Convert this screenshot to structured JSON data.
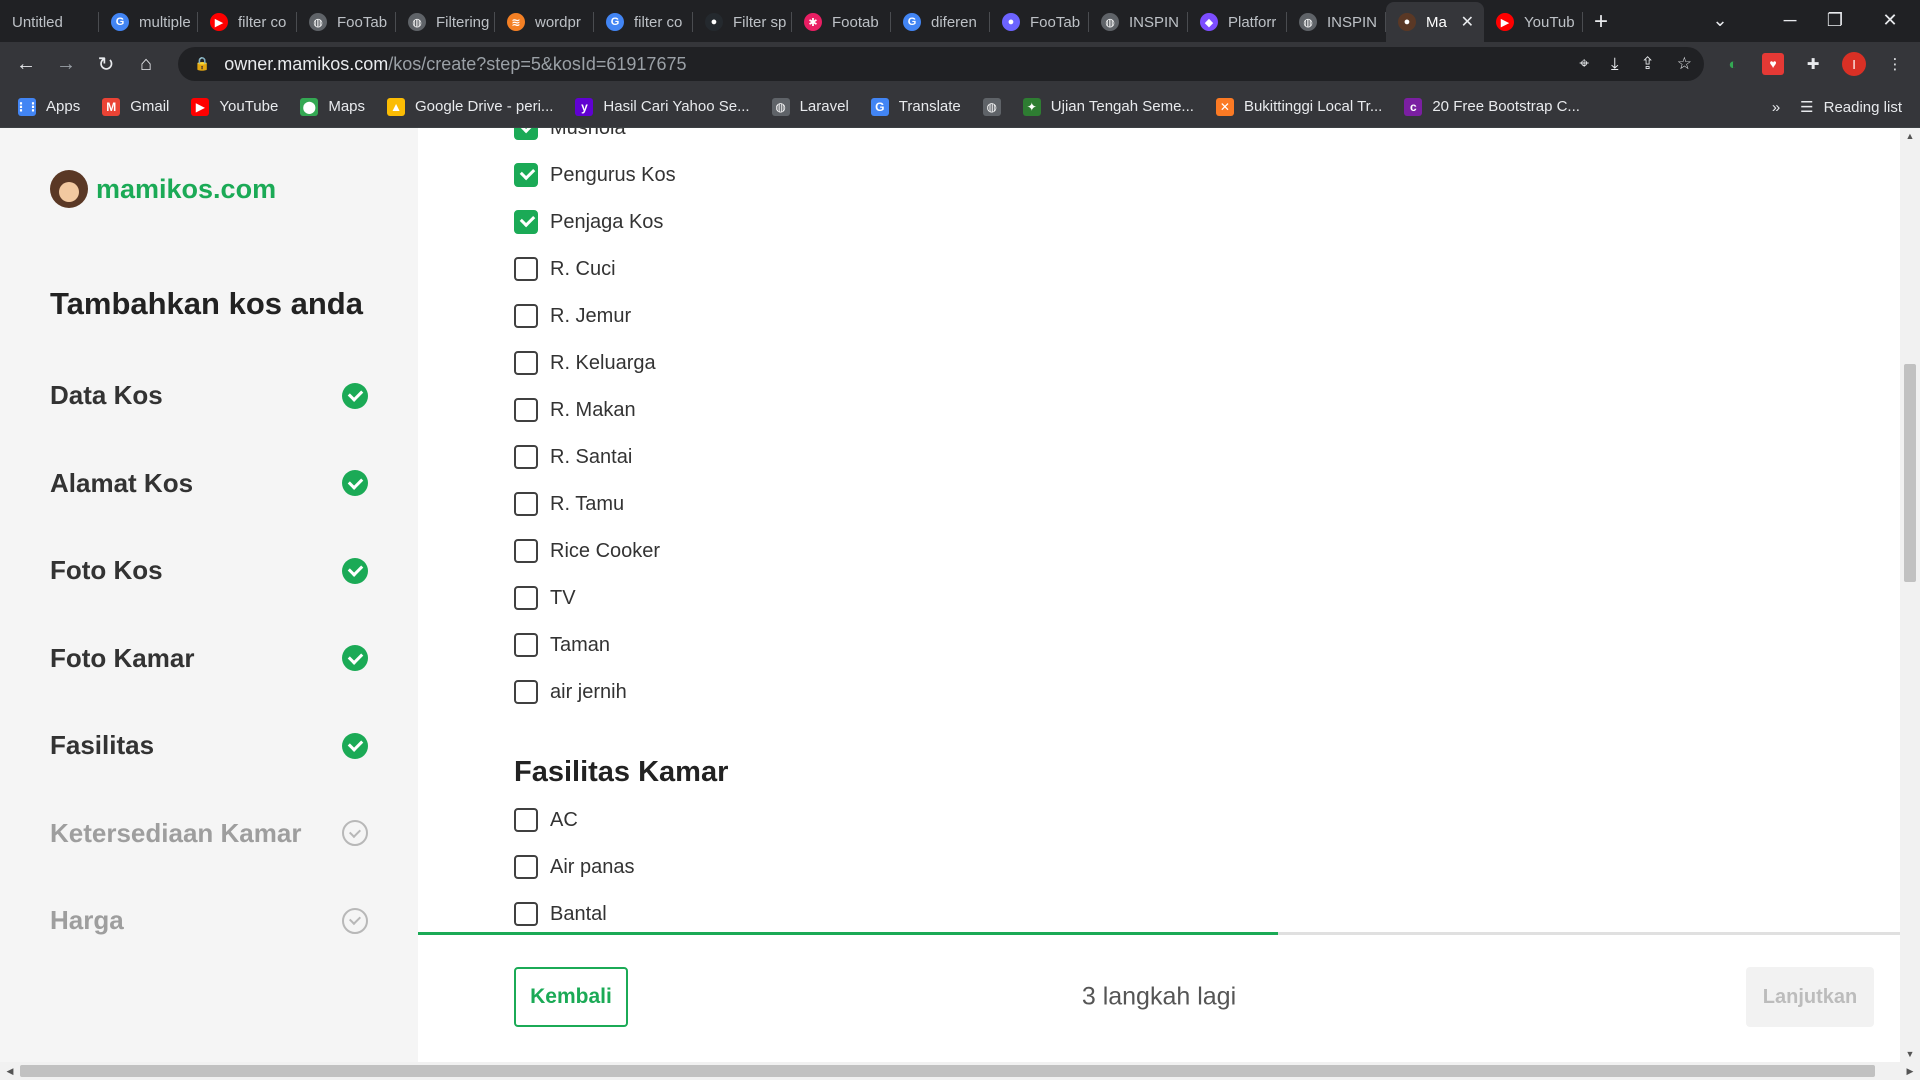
{
  "browser": {
    "tabs": [
      {
        "title": "Untitled",
        "icon": "doc-icon",
        "color": "#202124"
      },
      {
        "title": "multiple",
        "icon": "google-icon",
        "color": "#4285f4"
      },
      {
        "title": "filter co",
        "icon": "youtube-icon",
        "color": "#ff0000"
      },
      {
        "title": "FooTab",
        "icon": "globe-icon",
        "color": "#5f6368"
      },
      {
        "title": "Filtering",
        "icon": "globe-icon",
        "color": "#5f6368"
      },
      {
        "title": "wordpr",
        "icon": "stack-icon",
        "color": "#f48024"
      },
      {
        "title": "filter co",
        "icon": "google-icon",
        "color": "#4285f4"
      },
      {
        "title": "Filter sp",
        "icon": "github-icon",
        "color": "#24292e"
      },
      {
        "title": "Footab",
        "icon": "star-icon",
        "color": "#e91e63"
      },
      {
        "title": "diferen",
        "icon": "google-icon",
        "color": "#4285f4"
      },
      {
        "title": "FooTab",
        "icon": "circle-icon",
        "color": "#6c63ff"
      },
      {
        "title": "INSPIN",
        "icon": "globe-icon",
        "color": "#5f6368"
      },
      {
        "title": "Platforr",
        "icon": "platform-icon",
        "color": "#7c4dff"
      },
      {
        "title": "INSPIN",
        "icon": "globe-icon",
        "color": "#5f6368"
      },
      {
        "title": "Ma",
        "icon": "mamikos-icon",
        "color": "#5a3825",
        "active": true
      },
      {
        "title": "YouTub",
        "icon": "youtube-icon",
        "color": "#ff0000"
      }
    ],
    "url_host": "owner.mamikos.com",
    "url_path": "/kos/create?step=5&kosId=61917675",
    "profile_initial": "I",
    "bookmarks": [
      {
        "label": "Apps",
        "icon": "apps-icon",
        "color": "#4285f4"
      },
      {
        "label": "Gmail",
        "icon": "gmail-icon",
        "color": "#ea4335"
      },
      {
        "label": "YouTube",
        "icon": "youtube-icon",
        "color": "#ff0000"
      },
      {
        "label": "Maps",
        "icon": "maps-icon",
        "color": "#34a853"
      },
      {
        "label": "Google Drive - peri...",
        "icon": "drive-icon",
        "color": "#fbbc04"
      },
      {
        "label": "Hasil Cari Yahoo Se...",
        "icon": "yahoo-icon",
        "color": "#6001d2"
      },
      {
        "label": "Laravel",
        "icon": "globe-icon",
        "color": "#5f6368"
      },
      {
        "label": "Translate",
        "icon": "translate-icon",
        "color": "#4285f4"
      },
      {
        "label": "",
        "icon": "globe-icon",
        "color": "#5f6368"
      },
      {
        "label": "Ujian Tengah Seme...",
        "icon": "school-icon",
        "color": "#2e7d32"
      },
      {
        "label": "Bukittinggi Local Tr...",
        "icon": "xampp-icon",
        "color": "#fb7a24"
      },
      {
        "label": "20 Free Bootstrap C...",
        "icon": "colorlib-icon",
        "color": "#7b1fa2"
      }
    ],
    "reading_list": "Reading list"
  },
  "sidebar": {
    "logo_text": "mamikos.com",
    "title": "Tambahkan kos anda",
    "steps": [
      {
        "label": "Data Kos",
        "done": true
      },
      {
        "label": "Alamat Kos",
        "done": true
      },
      {
        "label": "Foto Kos",
        "done": true
      },
      {
        "label": "Foto Kamar",
        "done": true
      },
      {
        "label": "Fasilitas",
        "done": true
      },
      {
        "label": "Ketersediaan Kamar",
        "done": false
      },
      {
        "label": "Harga",
        "done": false
      }
    ]
  },
  "facilities": {
    "shared_items": [
      {
        "label": "Mushola",
        "checked": true
      },
      {
        "label": "Pengurus Kos",
        "checked": true
      },
      {
        "label": "Penjaga Kos",
        "checked": true
      },
      {
        "label": "R. Cuci",
        "checked": false
      },
      {
        "label": "R. Jemur",
        "checked": false
      },
      {
        "label": "R. Keluarga",
        "checked": false
      },
      {
        "label": "R. Makan",
        "checked": false
      },
      {
        "label": "R. Santai",
        "checked": false
      },
      {
        "label": "R. Tamu",
        "checked": false
      },
      {
        "label": "Rice Cooker",
        "checked": false
      },
      {
        "label": "TV",
        "checked": false
      },
      {
        "label": "Taman",
        "checked": false
      },
      {
        "label": "air jernih",
        "checked": false
      }
    ],
    "room_title": "Fasilitas Kamar",
    "room_items": [
      {
        "label": "AC",
        "checked": false
      },
      {
        "label": "Air panas",
        "checked": false
      },
      {
        "label": "Bantal",
        "checked": false
      }
    ]
  },
  "footer": {
    "back_label": "Kembali",
    "steps_left": "3 langkah lagi",
    "next_label": "Lanjutkan",
    "progress_fraction": 0.58
  },
  "colors": {
    "brand_green": "#1baa56",
    "sidebar_bg": "#f5f5f5"
  }
}
